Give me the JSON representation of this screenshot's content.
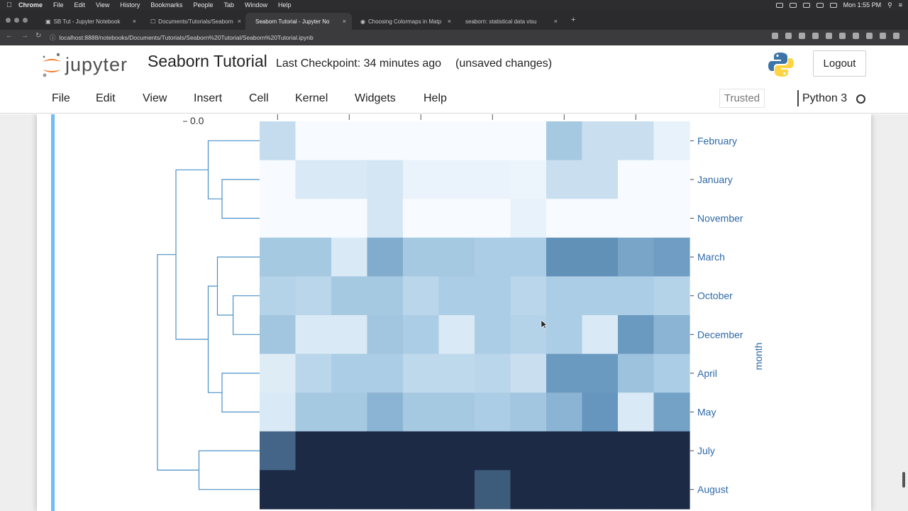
{
  "macos": {
    "apple": "",
    "menus": [
      "Chrome",
      "File",
      "Edit",
      "View",
      "History",
      "Bookmarks",
      "People",
      "Tab",
      "Window",
      "Help"
    ],
    "clock": "Mon 1:55 PM"
  },
  "browser": {
    "tabs": [
      {
        "label": "SB Tut - Jupyter Notebook",
        "active": false
      },
      {
        "label": "Documents/Tutorials/Seaborn",
        "active": false
      },
      {
        "label": "Seaborn Tutorial - Jupyter No",
        "active": true
      },
      {
        "label": "Choosing Colormaps in Matp",
        "active": false
      },
      {
        "label": "seaborn: statistical data visu",
        "active": false
      }
    ],
    "new_tab": "+",
    "url": "localhost:8888/notebooks/Documents/Tutorials/Seaborn%20Tutorial/Seaborn%20Tutorial.ipynb"
  },
  "jupyter": {
    "logo_text": "jupyter",
    "notebook_title": "Seaborn Tutorial",
    "checkpoint": "Last Checkpoint: 34 minutes ago",
    "unsaved": "(unsaved changes)",
    "logout_label": "Logout",
    "menu": [
      "File",
      "Edit",
      "View",
      "Insert",
      "Cell",
      "Kernel",
      "Widgets",
      "Help"
    ],
    "trusted_label": "Trusted",
    "kernel_name": "Python 3"
  },
  "chart_data": {
    "type": "heatmap",
    "colormap": "Blues",
    "colorbar_tick": "0.0",
    "ylabel": "month",
    "rows": [
      "February",
      "January",
      "November",
      "March",
      "October",
      "December",
      "April",
      "May",
      "July",
      "August"
    ],
    "levels": [
      [
        0.2,
        0.0,
        0.0,
        0.0,
        0.0,
        0.0,
        0.0,
        0.0,
        0.32,
        0.18,
        0.18,
        0.06
      ],
      [
        0.0,
        0.12,
        0.12,
        0.14,
        0.05,
        0.05,
        0.05,
        0.04,
        0.18,
        0.18,
        0.0,
        0.0
      ],
      [
        0.0,
        0.0,
        0.0,
        0.14,
        0.0,
        0.0,
        0.0,
        0.06,
        0.0,
        0.0,
        0.0,
        0.0
      ],
      [
        0.32,
        0.32,
        0.12,
        0.48,
        0.32,
        0.32,
        0.3,
        0.3,
        0.62,
        0.62,
        0.52,
        0.56
      ],
      [
        0.26,
        0.24,
        0.32,
        0.32,
        0.24,
        0.3,
        0.3,
        0.24,
        0.3,
        0.3,
        0.3,
        0.26
      ],
      [
        0.34,
        0.12,
        0.12,
        0.34,
        0.3,
        0.12,
        0.3,
        0.26,
        0.3,
        0.12,
        0.58,
        0.44
      ],
      [
        0.1,
        0.24,
        0.3,
        0.3,
        0.22,
        0.22,
        0.24,
        0.18,
        0.58,
        0.58,
        0.36,
        0.3
      ],
      [
        0.12,
        0.32,
        0.32,
        0.44,
        0.32,
        0.32,
        0.3,
        0.34,
        0.44,
        0.6,
        0.12,
        0.54
      ],
      [
        0.78,
        1.0,
        1.0,
        1.0,
        1.0,
        1.0,
        1.0,
        1.0,
        1.0,
        1.0,
        1.0,
        1.0
      ],
      [
        1.0,
        1.0,
        1.0,
        1.0,
        1.0,
        1.0,
        0.82,
        1.0,
        1.0,
        1.0,
        1.0,
        1.0
      ]
    ],
    "grid": false
  },
  "colors": {
    "tracker_blue": "#42a5f5",
    "dendrogram": "#4a90c8",
    "dark_cell": "#1c2a45"
  }
}
